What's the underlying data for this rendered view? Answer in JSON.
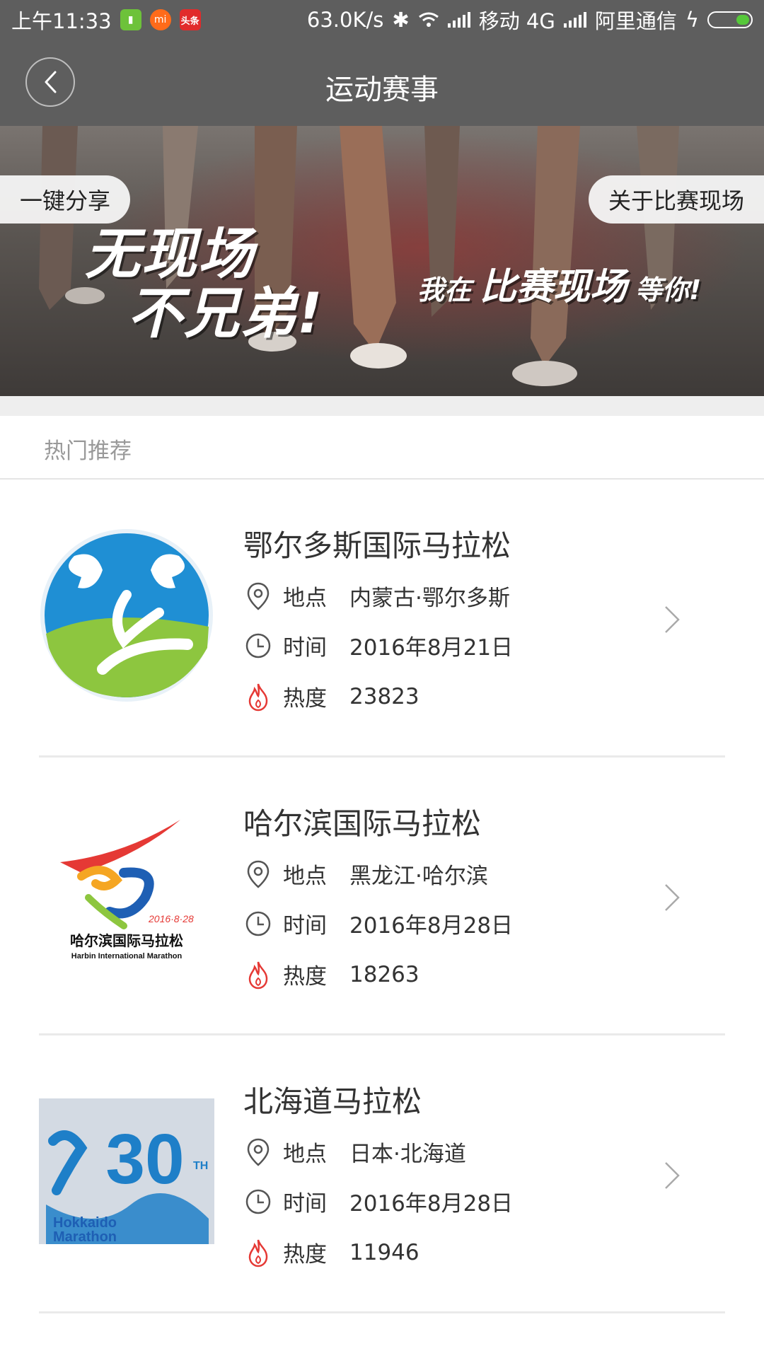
{
  "statusbar": {
    "time": "上午11:33",
    "apps": [
      "android-app-icon",
      "mi-app-icon",
      "toutiao-app-icon"
    ],
    "toutiao_label": "头条",
    "mi_label": "mi",
    "net_speed": "63.0K/s",
    "carrier1": "移动 4G",
    "carrier2": "阿里通信"
  },
  "header": {
    "title": "运动赛事"
  },
  "banner": {
    "slogan_left_line1": "无现场",
    "slogan_left_line2": "不兄弟!",
    "slogan_right_1": "我在",
    "slogan_right_2": "比赛现场",
    "slogan_right_3": "等你!",
    "share_label": "一键分享",
    "about_label": "关于比赛现场"
  },
  "section": {
    "title": "热门推荐"
  },
  "labels": {
    "location": "地点",
    "time": "时间",
    "heat": "热度"
  },
  "events": [
    {
      "name": "鄂尔多斯国际马拉松",
      "location": "内蒙古·鄂尔多斯",
      "date": "2016年8月21日",
      "heat": "23823"
    },
    {
      "name": "哈尔滨国际马拉松",
      "location": "黑龙江·哈尔滨",
      "date": "2016年8月28日",
      "heat": "18263",
      "logo_text_cn": "哈尔滨国际马拉松",
      "logo_text_en": "Harbin International Marathon",
      "logo_date": "2016·8·28"
    },
    {
      "name": "北海道马拉松",
      "location": "日本·北海道",
      "date": "2016年8月28日",
      "heat": "11946",
      "logo_number": "30",
      "logo_sup": "TH",
      "logo_text_en1": "Hokkaido",
      "logo_text_en2": "Marathon"
    }
  ],
  "colors": {
    "header_bg": "#5e5e5e",
    "heat_icon": "#e53935",
    "divider": "#eaeaea"
  }
}
